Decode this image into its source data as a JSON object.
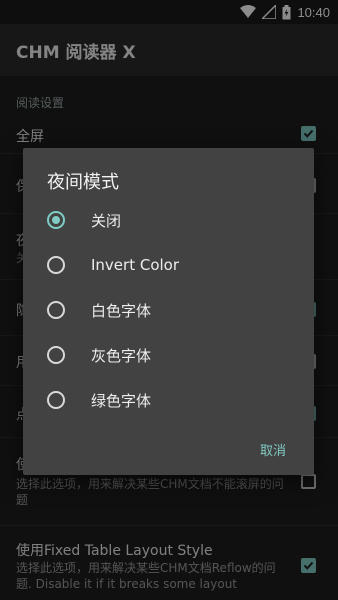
{
  "status_bar": {
    "time": "10:40"
  },
  "app_bar": {
    "title": "CHM 阅读器 X"
  },
  "settings": {
    "section_title": "阅读设置",
    "fullscreen": {
      "title": "全屏",
      "checked": true
    },
    "background_items": [
      {
        "title_fragment": "保",
        "checked": false
      },
      {
        "title_fragment": "夜",
        "summary_fragment": "关",
        "checked": false
      },
      {
        "title_fragment": "隐",
        "checked": true
      },
      {
        "title_fragment": "用",
        "checked": false
      },
      {
        "title_fragment": "点",
        "checked": true
      }
    ],
    "custom_css": {
      "title_fragment": "使",
      "summary": "选择此选项，用来解决某些CHM文档不能滚屏的问题",
      "checked": false
    },
    "fixed_table": {
      "title": "使用Fixed Table Layout Style",
      "summary": "选择此选项，用来解决某些CHM文档Reflow的问题. Disable it if it breaks some layout",
      "checked": true
    }
  },
  "dialog": {
    "title": "夜间模式",
    "options": [
      {
        "label": "关闭",
        "selected": true
      },
      {
        "label": "Invert Color",
        "selected": false
      },
      {
        "label": "白色字体",
        "selected": false
      },
      {
        "label": "灰色字体",
        "selected": false
      },
      {
        "label": "绿色字体",
        "selected": false
      }
    ],
    "cancel_label": "取消"
  },
  "colors": {
    "accent": "#80cbc4",
    "dialog_bg": "#424242",
    "page_bg": "#1e1e1e"
  }
}
